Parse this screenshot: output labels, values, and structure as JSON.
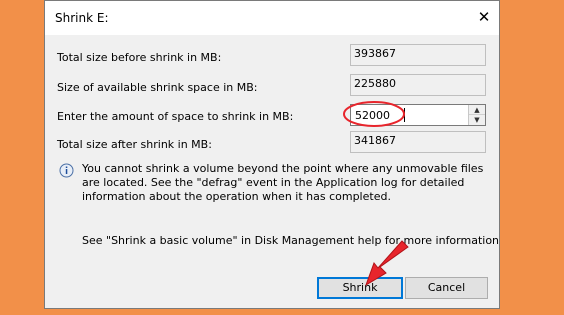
{
  "dialog": {
    "title": "Shrink E:",
    "close_glyph": "✕"
  },
  "fields": {
    "total_before_label": "Total size before shrink in MB:",
    "total_before_value": "393867",
    "available_label": "Size of available shrink space in MB:",
    "available_value": "225880",
    "amount_label": "Enter the amount of space to shrink in MB:",
    "amount_value": "52000",
    "total_after_label": "Total size after shrink in MB:",
    "total_after_value": "341867"
  },
  "info": {
    "icon": "info-icon",
    "text": "You cannot shrink a volume beyond the point where any unmovable files are located. See the \"defrag\" event in the Application log for detailed information about the operation when it has completed."
  },
  "help": {
    "text": "See \"Shrink a basic volume\" in Disk Management help for more information"
  },
  "buttons": {
    "shrink": "Shrink",
    "cancel": "Cancel"
  },
  "colors": {
    "background": "#F29049",
    "annotation_red": "#E8252C",
    "focus_blue": "#0078D7"
  }
}
